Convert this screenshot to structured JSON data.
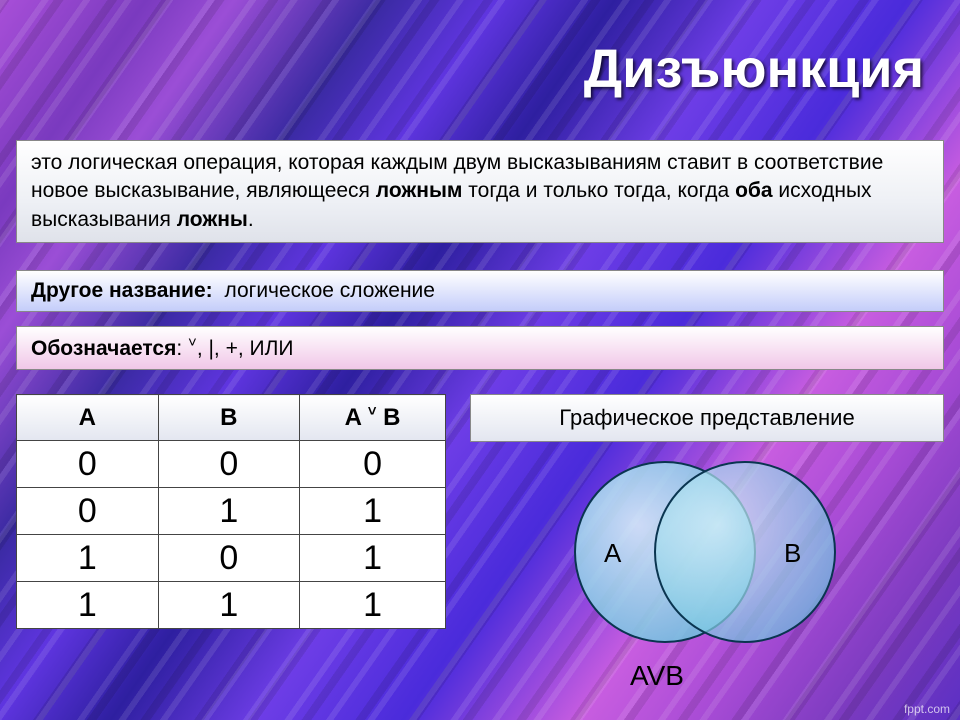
{
  "title": "Дизъюнкция",
  "definition": {
    "pre": "это логическая операция, которая каждым двум высказываниям ставит в соответствие новое высказывание, являющееся ",
    "bold1": "ложным",
    "mid1": " тогда и только тогда, когда ",
    "bold2": "оба",
    "mid2": " исходных высказывания ",
    "bold3": "ложны",
    "post": "."
  },
  "alt_name": {
    "label": "Другое название:",
    "value": "логическое сложение"
  },
  "notation": {
    "label": "Обозначается",
    "colon": ":",
    "symbols_vee": "˅",
    "symbols_rest": ", |, +, ИЛИ"
  },
  "table": {
    "headers": {
      "a": "A",
      "b": "B",
      "expr_a": "A ",
      "expr_vee": "˅",
      "expr_b": " B"
    },
    "rows": [
      {
        "a": "0",
        "b": "0",
        "r": "0"
      },
      {
        "a": "0",
        "b": "1",
        "r": "1"
      },
      {
        "a": "1",
        "b": "0",
        "r": "1"
      },
      {
        "a": "1",
        "b": "1",
        "r": "1"
      }
    ]
  },
  "graphic_header": "Графическое представление",
  "venn_labels": {
    "a": "A",
    "b": "B"
  },
  "caption": "AVB",
  "footer": "fppt.com"
}
